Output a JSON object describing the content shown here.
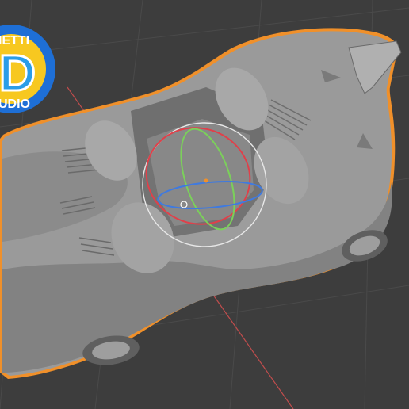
{
  "viewport": {
    "background": "#3d3d3d",
    "grid_color": "#4a4a4a",
    "selection_outline": "#f0902a",
    "axis_x_color": "#c24d4d",
    "axis_y_color": "#6a9a3a"
  },
  "gizmo": {
    "type": "rotate",
    "ring_x_color": "#e0404a",
    "ring_y_color": "#7bd05a",
    "ring_z_color": "#3f7ae0",
    "outer_ring_color": "#e8e8e8"
  },
  "object": {
    "body_color": "#9a9a9a",
    "shade_color": "#777777"
  },
  "logo": {
    "text_top": "NETTI",
    "text_mid": "D",
    "text_bottom": "UDIO",
    "ring_color": "#1e6fd6",
    "fill_color": "#f7c820",
    "letter_color": "#2a9de8"
  }
}
